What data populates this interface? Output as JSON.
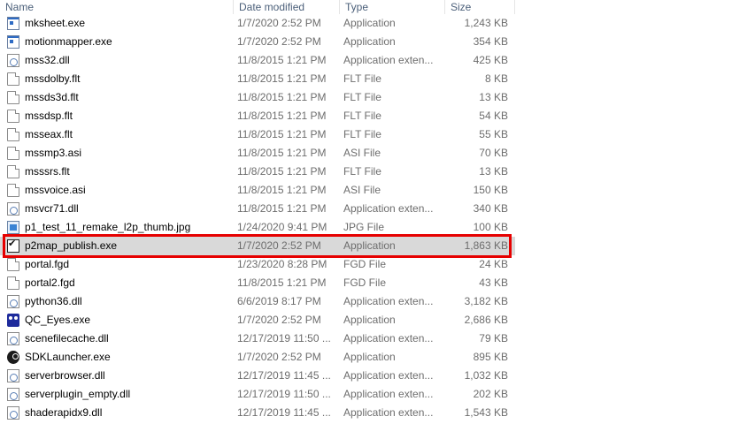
{
  "columns": {
    "name": "Name",
    "date_modified": "Date modified",
    "type": "Type",
    "size": "Size"
  },
  "files": [
    {
      "name": "mksheet.exe",
      "date": "1/7/2020 2:52 PM",
      "type": "Application",
      "size": "1,243 KB",
      "icon": "application-icon"
    },
    {
      "name": "motionmapper.exe",
      "date": "1/7/2020 2:52 PM",
      "type": "Application",
      "size": "354 KB",
      "icon": "application-icon"
    },
    {
      "name": "mss32.dll",
      "date": "11/8/2015 1:21 PM",
      "type": "Application exten...",
      "size": "425 KB",
      "icon": "dll-icon"
    },
    {
      "name": "mssdolby.flt",
      "date": "11/8/2015 1:21 PM",
      "type": "FLT File",
      "size": "8 KB",
      "icon": "file-icon"
    },
    {
      "name": "mssds3d.flt",
      "date": "11/8/2015 1:21 PM",
      "type": "FLT File",
      "size": "13 KB",
      "icon": "file-icon"
    },
    {
      "name": "mssdsp.flt",
      "date": "11/8/2015 1:21 PM",
      "type": "FLT File",
      "size": "54 KB",
      "icon": "file-icon"
    },
    {
      "name": "msseax.flt",
      "date": "11/8/2015 1:21 PM",
      "type": "FLT File",
      "size": "55 KB",
      "icon": "file-icon"
    },
    {
      "name": "mssmp3.asi",
      "date": "11/8/2015 1:21 PM",
      "type": "ASI File",
      "size": "70 KB",
      "icon": "file-icon"
    },
    {
      "name": "msssrs.flt",
      "date": "11/8/2015 1:21 PM",
      "type": "FLT File",
      "size": "13 KB",
      "icon": "file-icon"
    },
    {
      "name": "mssvoice.asi",
      "date": "11/8/2015 1:21 PM",
      "type": "ASI File",
      "size": "150 KB",
      "icon": "file-icon"
    },
    {
      "name": "msvcr71.dll",
      "date": "11/8/2015 1:21 PM",
      "type": "Application exten...",
      "size": "340 KB",
      "icon": "dll-icon"
    },
    {
      "name": "p1_test_11_remake_l2p_thumb.jpg",
      "date": "1/24/2020 9:41 PM",
      "type": "JPG File",
      "size": "100 KB",
      "icon": "image-icon"
    },
    {
      "name": "p2map_publish.exe",
      "date": "1/7/2020 2:52 PM",
      "type": "Application",
      "size": "1,863 KB",
      "icon": "checkbox-app-icon",
      "selected": true
    },
    {
      "name": "portal.fgd",
      "date": "1/23/2020 8:28 PM",
      "type": "FGD File",
      "size": "24 KB",
      "icon": "file-icon"
    },
    {
      "name": "portal2.fgd",
      "date": "11/8/2015 1:21 PM",
      "type": "FGD File",
      "size": "43 KB",
      "icon": "file-icon"
    },
    {
      "name": "python36.dll",
      "date": "6/6/2019 8:17 PM",
      "type": "Application exten...",
      "size": "3,182 KB",
      "icon": "dll-icon"
    },
    {
      "name": "QC_Eyes.exe",
      "date": "1/7/2020 2:52 PM",
      "type": "Application",
      "size": "2,686 KB",
      "icon": "qc-eyes-icon"
    },
    {
      "name": "scenefilecache.dll",
      "date": "12/17/2019 11:50 ...",
      "type": "Application exten...",
      "size": "79 KB",
      "icon": "dll-icon"
    },
    {
      "name": "SDKLauncher.exe",
      "date": "1/7/2020 2:52 PM",
      "type": "Application",
      "size": "895 KB",
      "icon": "steam-icon"
    },
    {
      "name": "serverbrowser.dll",
      "date": "12/17/2019 11:45 ...",
      "type": "Application exten...",
      "size": "1,032 KB",
      "icon": "dll-icon"
    },
    {
      "name": "serverplugin_empty.dll",
      "date": "12/17/2019 11:50 ...",
      "type": "Application exten...",
      "size": "202 KB",
      "icon": "dll-icon"
    },
    {
      "name": "shaderapidx9.dll",
      "date": "12/17/2019 11:45 ...",
      "type": "Application exten...",
      "size": "1,543 KB",
      "icon": "dll-icon"
    }
  ],
  "colors": {
    "highlight_border": "#e60000",
    "selected_row": "#d9d9d9",
    "header_text": "#4c607a",
    "secondary_text": "#6d6d6d"
  }
}
